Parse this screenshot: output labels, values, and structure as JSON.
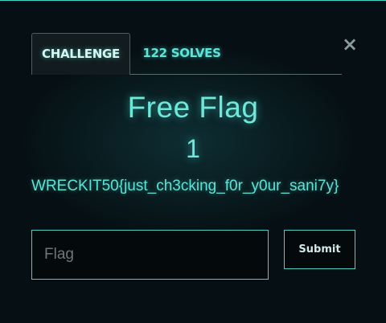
{
  "modal": {
    "close_glyph": "×",
    "tabs": [
      {
        "label": "CHALLENGE"
      },
      {
        "label": "122 SOLVES"
      }
    ],
    "challenge": {
      "title": "Free Flag",
      "points": "1",
      "description": "WRECKIT50{just_ch3cking_f0r_y0ur_sani7y}"
    },
    "form": {
      "flag_placeholder": "Flag",
      "flag_value": "",
      "submit_label": "Submit"
    }
  },
  "colors": {
    "accent": "#5ae6d8",
    "background": "#061014",
    "border": "#4ccfc2"
  }
}
